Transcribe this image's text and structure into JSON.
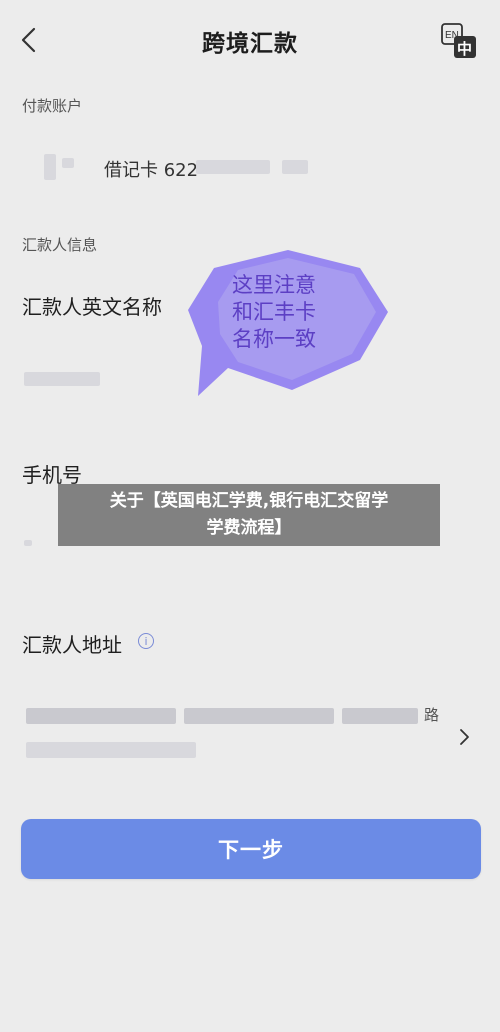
{
  "header": {
    "title": "跨境汇款",
    "back_icon": "back-arrow-icon",
    "language_icon": "language-switch-icon",
    "language_icon_top": "EN",
    "language_icon_bottom": "中"
  },
  "payment_account": {
    "label": "付款账户",
    "card_text": "借记卡 622"
  },
  "remitter_info": {
    "section_label": "汇款人信息",
    "english_name_label": "汇款人英文名称",
    "phone_label": "手机号",
    "address_label": "汇款人地址",
    "address_info_icon": "info-icon",
    "address_trailing_char": "路"
  },
  "callout": {
    "text_line1": "这里注意",
    "text_line2": "和汇丰卡",
    "text_line3": "名称一致",
    "color": "#8f7df2"
  },
  "banner": {
    "line1": "关于【英国电汇学费,银行电汇交留学",
    "line2": "学费流程】"
  },
  "footer": {
    "next_button_label": "下一步",
    "accent_color": "#6b8be6"
  }
}
